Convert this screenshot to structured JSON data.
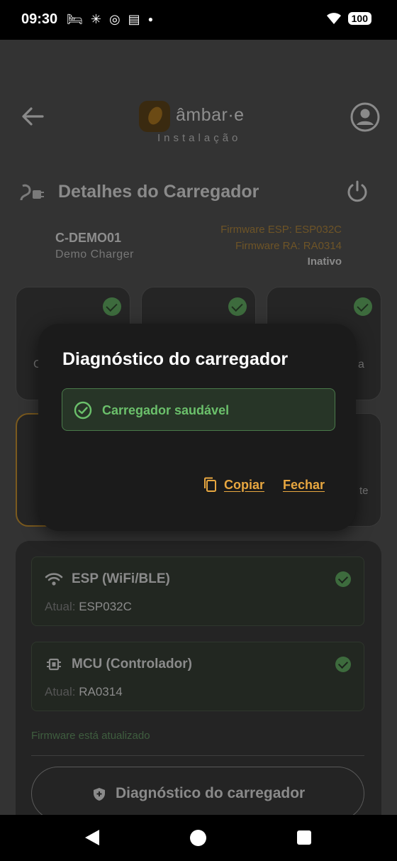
{
  "status_bar": {
    "time": "09:30",
    "battery": "100"
  },
  "header": {
    "brand": "âmbar·e",
    "subtitle": "Instalação"
  },
  "page": {
    "title": "Detalhes do Carregador"
  },
  "charger": {
    "id": "C-DEMO01",
    "name": "Demo Charger",
    "firmware_esp": "Firmware ESP: ESP032C",
    "firmware_ra": "Firmware RA: RA0314",
    "state": "Inativo"
  },
  "cards": {
    "left_partial_text": "C",
    "right_partial_text": "a",
    "right2_partial_text": "te"
  },
  "firmware_panel": {
    "esp": {
      "name": "ESP (WiFi/BLE)",
      "label": "Atual:",
      "value": "ESP032C"
    },
    "mcu": {
      "name": "MCU (Controlador)",
      "label": "Atual:",
      "value": "RA0314"
    },
    "status": "Firmware está atualizado",
    "diagnostic_button": "Diagnóstico do carregador"
  },
  "dialog": {
    "title": "Diagnóstico do carregador",
    "health_text": "Carregador saudável",
    "copy_label": "Copiar",
    "close_label": "Fechar",
    "accent_color": "#e8a740",
    "success_color": "#6bc06b"
  }
}
